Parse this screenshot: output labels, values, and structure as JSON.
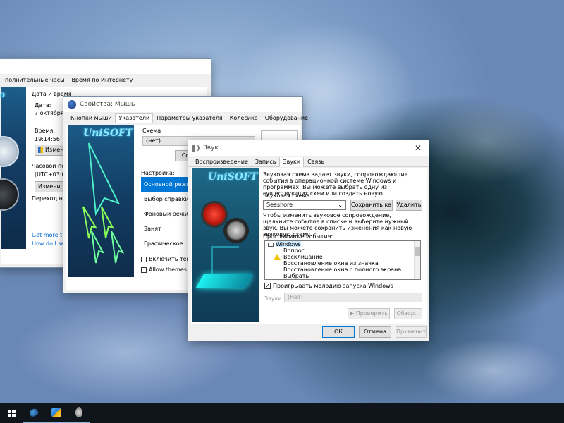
{
  "desktop": {
    "wallpaper": "ocean-wave"
  },
  "datetime_window": {
    "tabs": [
      "полнительные часы",
      "Время по Интернету"
    ],
    "group_label": "Дата и время",
    "date_label": "Дата:",
    "date_value": "7 октября 2",
    "time_label": "Время:",
    "time_value": "19:14:56",
    "change_button": "Измен",
    "timezone_label": "Часовой пояс",
    "timezone_value": "(UTC+03:00)",
    "change_tz_button": "Измени",
    "dst_text": "Переход на з",
    "link1": "Get more tim",
    "link2": "How do I set"
  },
  "mouse_window": {
    "title": "Свойства: Мышь",
    "tabs": [
      "Кнопки мыши",
      "Указатели",
      "Параметры указателя",
      "Колесико",
      "Оборудование"
    ],
    "active_tab": 1,
    "logo": "UniSOFT",
    "scheme_label": "Схема",
    "scheme_value": "(нет)",
    "save_button": "Сохр",
    "customize_label": "Настройка:",
    "cursor_list": [
      "Основной режим",
      "Выбор справки",
      "Фоновый режим",
      "Занят",
      "Графическое выдел"
    ],
    "selected_cursor": 0,
    "shadow_checkbox": "Включить тень ука",
    "themes_checkbox": "Allow themes to cha"
  },
  "sound_window": {
    "title": "Звук",
    "close": "✕",
    "tabs": [
      "Воспроизведение",
      "Запись",
      "Звуки",
      "Связь"
    ],
    "active_tab": 2,
    "logo": "UniSOFT",
    "description": "Звуковая схема задает звуки, сопровождающие события в операционной системе Windows и программах. Вы можете выбрать одну из существующих схем или создать новую.",
    "scheme_label": "Звуковая схема:",
    "scheme_value": "Seashore",
    "save_as_button": "Сохранить как...",
    "delete_button": "Удалить",
    "change_text": "Чтобы изменить звуковое сопровождение, щелкните событие в списке и выберите нужный звук. Вы можете сохранить изменения как новую звуковую схему.",
    "events_label": "Программные события:",
    "events": [
      {
        "label": "Windows",
        "icon": "window-icon",
        "group": true
      },
      {
        "label": "Вопрос",
        "icon": "",
        "group": false
      },
      {
        "label": "Восклицание",
        "icon": "warning-icon",
        "group": false
      },
      {
        "label": "Восстановление окна из значка",
        "icon": "",
        "group": false
      },
      {
        "label": "Восстановление окна с полного экрана",
        "icon": "",
        "group": false
      },
      {
        "label": "Выбрать",
        "icon": "",
        "group": false
      }
    ],
    "startup_checkbox": "Проигрывать мелодию запуска Windows",
    "startup_checked": true,
    "sounds_label": "Звуки:",
    "sounds_value": "(Нет)",
    "test_button": "▶ Проверить",
    "browse_button": "Обзор...",
    "ok_button": "ОК",
    "cancel_button": "Отмена",
    "apply_button": "Применить"
  },
  "taskbar": {
    "items": [
      "start-icon",
      "mouse-icon",
      "control-panel-icon",
      "sound-icon"
    ]
  }
}
